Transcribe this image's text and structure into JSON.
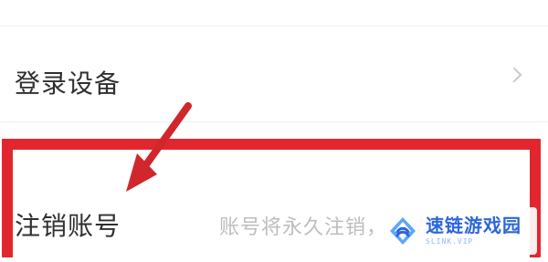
{
  "settings": {
    "items": [
      {
        "label": "登录设备",
        "icon": "chevron-right-icon"
      },
      {
        "label": "注销账号",
        "description": "账号将永久注销，无法恢复"
      }
    ]
  },
  "annotation": {
    "highlight_color": "#e2262e",
    "arrow_color": "#d1262b"
  },
  "watermark": {
    "logo_icon": "diamond-link-icon",
    "title": "速链游戏园",
    "subtitle": "SLINK.VIP"
  }
}
